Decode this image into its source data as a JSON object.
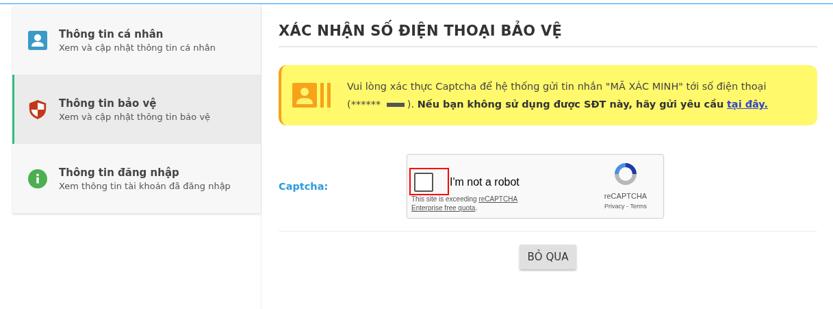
{
  "sidebar": {
    "items": [
      {
        "kind": "person",
        "title": "Thông tin cá nhân",
        "subtitle": "Xem và cập nhật thông tin cá nhân",
        "selected": false
      },
      {
        "kind": "shield",
        "title": "Thông tin bảo vệ",
        "subtitle": "Xem và cập nhật thông tin bảo vệ",
        "selected": true
      },
      {
        "kind": "info",
        "title": "Thông tin đăng nhập",
        "subtitle": "Xem thông tin tài khoản đã đăng nhập",
        "selected": false
      }
    ]
  },
  "page_title": "XÁC NHẬN SỐ ĐIỆN THOẠI BẢO VỆ",
  "notice": {
    "text_before": "Vui lòng xác thực Captcha để hệ thống gửi tin nhắn \"MÃ XÁC MINH\" tới số điện thoại (******",
    "text_after": ").",
    "bold_text": "Nếu bạn không sử dụng được SĐT này, hãy gửi yêu cầu",
    "link": "tại đây."
  },
  "captcha": {
    "label": "Captcha:",
    "checked": false,
    "checkbox_label": "I'm not a robot",
    "quota_text": "This site is exceeding",
    "quota_link_1": "reCAPTCHA",
    "quota_link_2": "Enterprise free quota",
    "quota_end": ".",
    "brand": "reCAPTCHA",
    "privacy": "Privacy",
    "separator": "-",
    "terms": "Terms"
  },
  "buttons": [
    {
      "label": "BỎ QUA"
    }
  ]
}
